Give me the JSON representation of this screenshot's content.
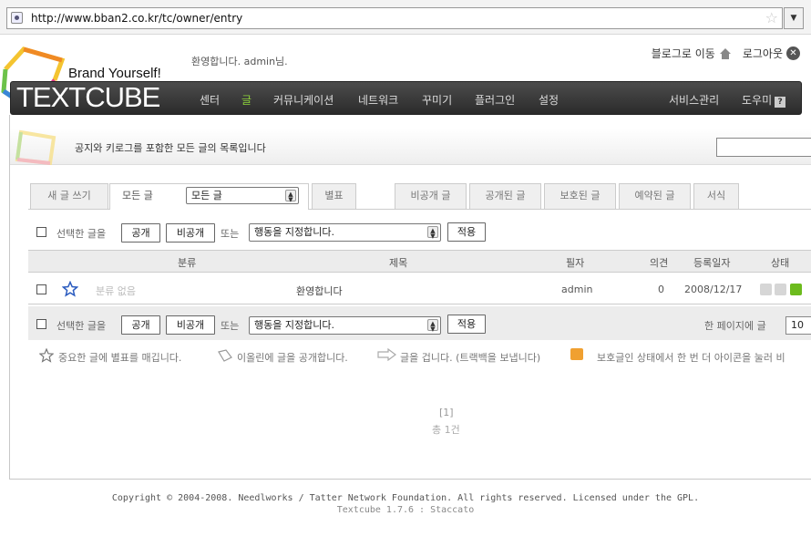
{
  "browser": {
    "url": "http://www.bban2.co.kr/tc/owner/entry"
  },
  "header": {
    "brand_tagline": "Brand Yourself!",
    "logo_text": "TEXTCUBE",
    "welcome": "환영합니다. admin님.",
    "go_blog": "블로그로 이동",
    "logout": "로그아웃"
  },
  "nav": {
    "items": [
      "센터",
      "글",
      "커뮤니케이션",
      "네트워크",
      "꾸미기",
      "플러그인",
      "설정"
    ],
    "active_index": 1,
    "service_admin": "서비스관리",
    "help": "도우미"
  },
  "page": {
    "title": "공지와 키로그를 포함한 모든 글의 목록입니다"
  },
  "tabs": {
    "write": "새 글 쓰기",
    "all": "모든 글",
    "filter_selected": "모든 글",
    "starred": "별표",
    "private": "비공개 글",
    "public": "공개된 글",
    "protected": "보호된 글",
    "scheduled": "예약된 글",
    "template": "서식"
  },
  "actions": {
    "select_label": "선택한 글을",
    "public_btn": "공개",
    "private_btn": "비공개",
    "or": "또는",
    "action_placeholder": "행동을 지정합니다.",
    "apply_btn": "적용",
    "per_page_label": "한 페이지에 글",
    "per_page_value": "10"
  },
  "table": {
    "headers": {
      "category": "분류",
      "title": "제목",
      "author": "필자",
      "comments": "의견",
      "date": "등록일자",
      "status": "상태"
    },
    "rows": [
      {
        "category": "분류 없음",
        "title": "환영합니다",
        "author": "admin",
        "comments": "0",
        "date": "2008/12/17"
      }
    ]
  },
  "legend": {
    "star": "중요한 글에 별표를 매깁니다.",
    "publish": "이올린에 글을 공개합니다.",
    "trackback": "글을 겁니다. (트랙백을 보냅니다)",
    "protect": "보호글인 상태에서 한 번 더 아이콘을 눌러 비"
  },
  "pagination": {
    "pages": "[1]",
    "total": "총 1건"
  },
  "footer": {
    "copyright": "Copyright © 2004-2008. Needlworks / Tatter Network Foundation. All rights reserved. Licensed under the GPL.",
    "version": "Textcube 1.7.6 : Staccato"
  },
  "colors": {
    "nav_active": "#8ed43a",
    "status_green": "#6cbb1d",
    "key_orange": "#f0a030"
  }
}
